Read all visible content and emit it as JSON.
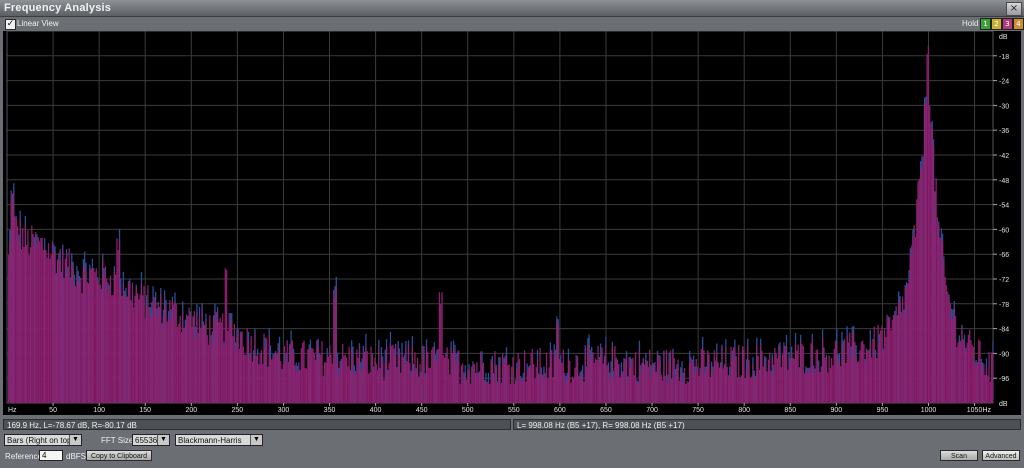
{
  "window": {
    "title": "Frequency Analysis",
    "close_glyph": "×"
  },
  "toolbar": {
    "linear_view_label": "Linear View",
    "linear_view_checked": true,
    "hold_label": "Hold",
    "hold_buttons": [
      {
        "label": "1",
        "color": "#3aa13a"
      },
      {
        "label": "2",
        "color": "#c8b030"
      },
      {
        "label": "3",
        "color": "#b03a7a"
      },
      {
        "label": "4",
        "color": "#c89030"
      }
    ]
  },
  "status": {
    "cursor": "169.9 Hz, L=-78.67 dB, R=-80.17 dB",
    "peak": "L= 998.08 Hz (B5 +17), R= 998.08 Hz (B5 +17)"
  },
  "controls": {
    "display_mode": "Bars (Right on top)",
    "fft_label": "FFT Size",
    "fft_size": "65536",
    "window_fn": "Blackmann-Harris",
    "reference_label": "Reference",
    "reference_value": "4",
    "reference_unit": "dBFS",
    "copy_button": "Copy to Clipboard",
    "scan_button": "Scan",
    "advanced_button": "Advanced"
  },
  "chart_data": {
    "type": "bar",
    "title": "",
    "xlabel": "Hz",
    "ylabel": "dB",
    "xlim": [
      0,
      1070
    ],
    "ylim": [
      -102,
      -12
    ],
    "x_ticks": [
      50,
      100,
      150,
      200,
      250,
      300,
      350,
      400,
      450,
      500,
      550,
      600,
      650,
      700,
      750,
      800,
      850,
      900,
      950,
      1000,
      1050
    ],
    "y_ticks": [
      -18,
      -24,
      -30,
      -36,
      -42,
      -48,
      -54,
      -60,
      -66,
      -72,
      -78,
      -84,
      -90,
      -96
    ],
    "grid": true,
    "colors": {
      "left": "#8a1f6e",
      "right": "#2a4d9a",
      "overlap": "#8a2570"
    },
    "envelope": {
      "x": [
        0,
        5,
        20,
        40,
        60,
        80,
        100,
        120,
        140,
        160,
        180,
        200,
        220,
        240,
        260,
        280,
        300,
        340,
        400,
        450,
        500,
        550,
        600,
        650,
        700,
        750,
        800,
        850,
        900,
        940,
        960,
        975,
        985,
        992,
        996,
        998,
        1000,
        1004,
        1010,
        1020,
        1030,
        1045,
        1060,
        1070
      ],
      "y": [
        -70,
        -58,
        -63,
        -64,
        -68,
        -71,
        -71,
        -73,
        -76,
        -79,
        -80,
        -82,
        -84,
        -84,
        -87,
        -89,
        -91,
        -91,
        -92,
        -92,
        -93,
        -93,
        -93,
        -92,
        -93,
        -93,
        -92,
        -91,
        -90,
        -88,
        -84,
        -76,
        -60,
        -44,
        -30,
        -21,
        -24,
        -40,
        -60,
        -76,
        -84,
        -89,
        -92,
        -94
      ]
    },
    "peaks": [
      {
        "x": 998,
        "y": -18
      },
      {
        "x": 5,
        "y": -54
      },
      {
        "x": 120,
        "y": -65
      },
      {
        "x": 237,
        "y": -71
      },
      {
        "x": 355,
        "y": -77
      },
      {
        "x": 470,
        "y": -78
      },
      {
        "x": 597,
        "y": -84
      }
    ]
  }
}
